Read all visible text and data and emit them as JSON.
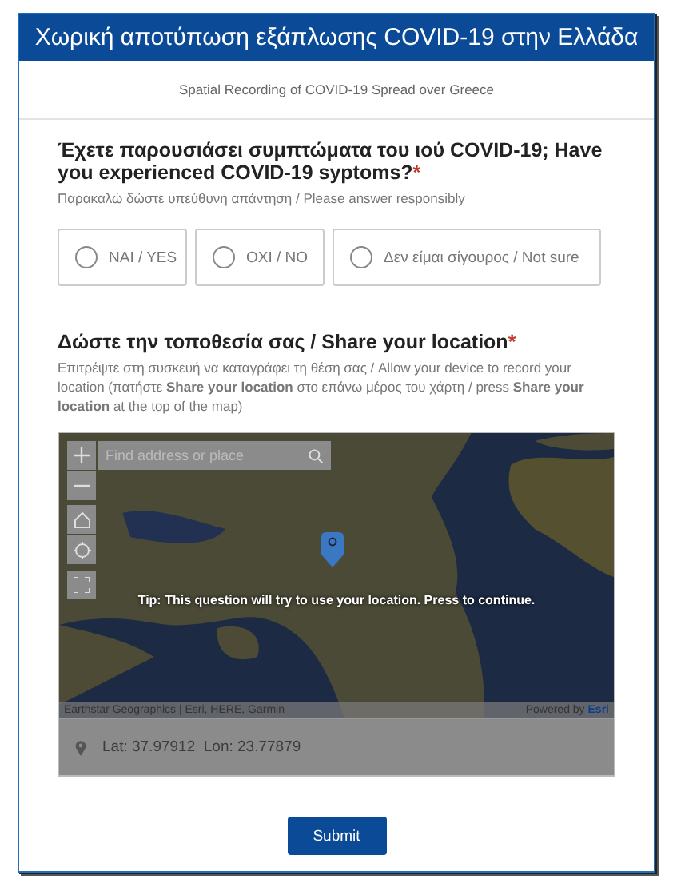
{
  "header": {
    "title": "Χωρική αποτύπωση εξάπλωσης COVID-19 στην Ελλάδα",
    "subtitle": "Spatial Recording of COVID-19 Spread over Greece"
  },
  "questions": [
    {
      "kind": "choice",
      "label": "Έχετε παρουσιάσει συμπτώματα του ιού COVID-19; Have you experienced COVID-19 syptoms?",
      "required_mark": "*",
      "hint": "Παρακαλώ δώστε υπεύθυνη απάντηση / Please answer responsibly",
      "options": [
        {
          "label": "NAI / YES",
          "selected": false
        },
        {
          "label": "OXI / NO",
          "selected": false
        },
        {
          "label": "Δεν είμαι σίγουρος / Not sure",
          "selected": false
        }
      ]
    },
    {
      "kind": "location",
      "label": "Δώστε την τοποθεσία σας / Share your location",
      "required_mark": "*",
      "hint": "Επιτρέψτε στη συσκευή να καταγράφει τη θέση σας / Allow your device to record your location (πατήστε **Share your location** στο επάνω μέρος του χάρτη / press **Share your location** at the top of the map)",
      "map": {
        "search_placeholder": "Find address or place",
        "tip": "Tip: This question will try to use your location. Press to continue.",
        "attribution": "Earthstar Geographics | Esri, HERE, Garmin",
        "powered_by": "Powered by",
        "powered_link": "Esri",
        "coordinates": "Lat: 37.97912  Lon: 23.77879"
      }
    }
  ],
  "submit": "Submit"
}
